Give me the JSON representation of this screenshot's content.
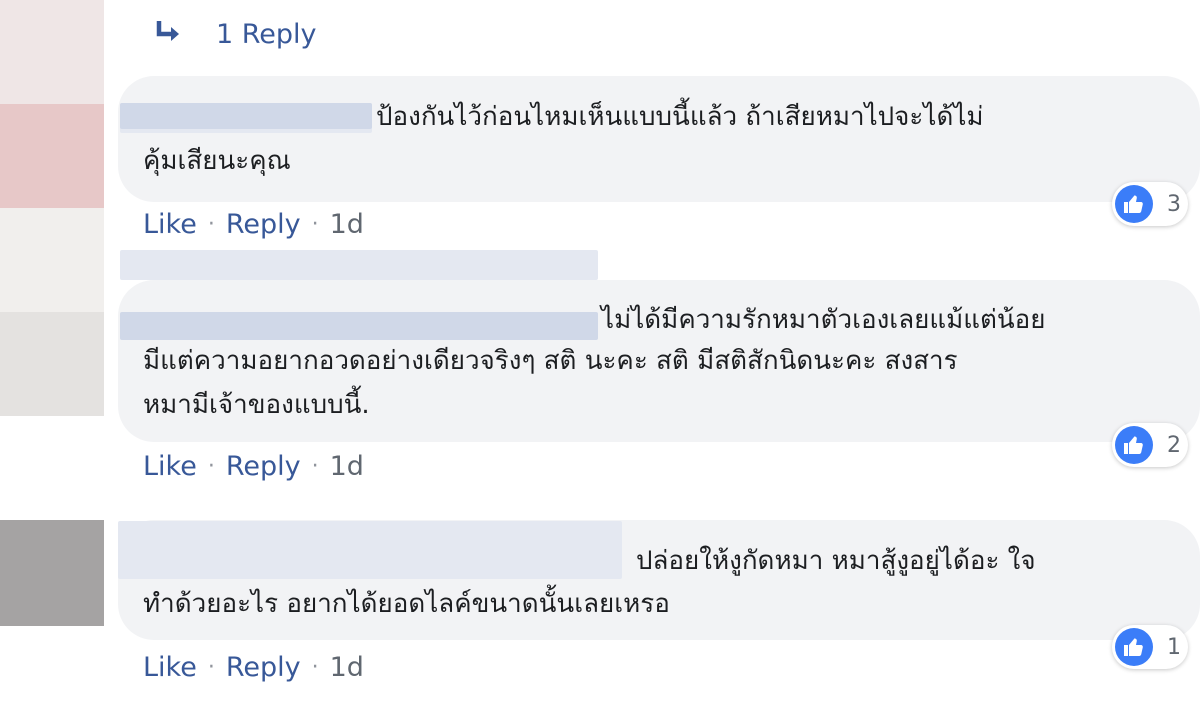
{
  "reply_link": {
    "label": "1 Reply"
  },
  "comments": [
    {
      "text_lines": [
        "ป้องกันไว้ก่อนไหมเห็นแบบนี้แล้ว ถ้าเสียหมาไปจะได้ไม่",
        "คุ้มเสียนะคุณ"
      ],
      "reactions": "3",
      "like_label": "Like",
      "reply_label": "Reply",
      "separator": "·",
      "time": "1d"
    },
    {
      "text_lines": [
        "ไม่ได้มีความรักหมาตัวเองเลยแม้แต่น้อย",
        "มีแต่ความอยากอวดอย่างเดียวจริงๆ สติ นะคะ สติ มีสติสักนิดนะคะ สงสาร",
        "หมามีเจ้าของแบบนี้."
      ],
      "reactions": "2",
      "like_label": "Like",
      "reply_label": "Reply",
      "separator": "·",
      "time": "1d"
    },
    {
      "text_lines": [
        "ปล่อยให้งูกัดหมา หมาสู้งูอยู่ได้อะ ใจ",
        "ทำด้วยอะไร อยากได้ยอดไลค์ขนาดนั้นเลยเหรอ"
      ],
      "reactions": "1",
      "like_label": "Like",
      "reply_label": "Reply",
      "separator": "·",
      "time": "1d"
    }
  ],
  "colors": {
    "link": "#385898",
    "bubble": "#f2f3f5",
    "like_blue": "#3b7df8",
    "meta": "#606770"
  },
  "icons": [
    "reply-arrow-icon",
    "thumbs-up-icon"
  ]
}
